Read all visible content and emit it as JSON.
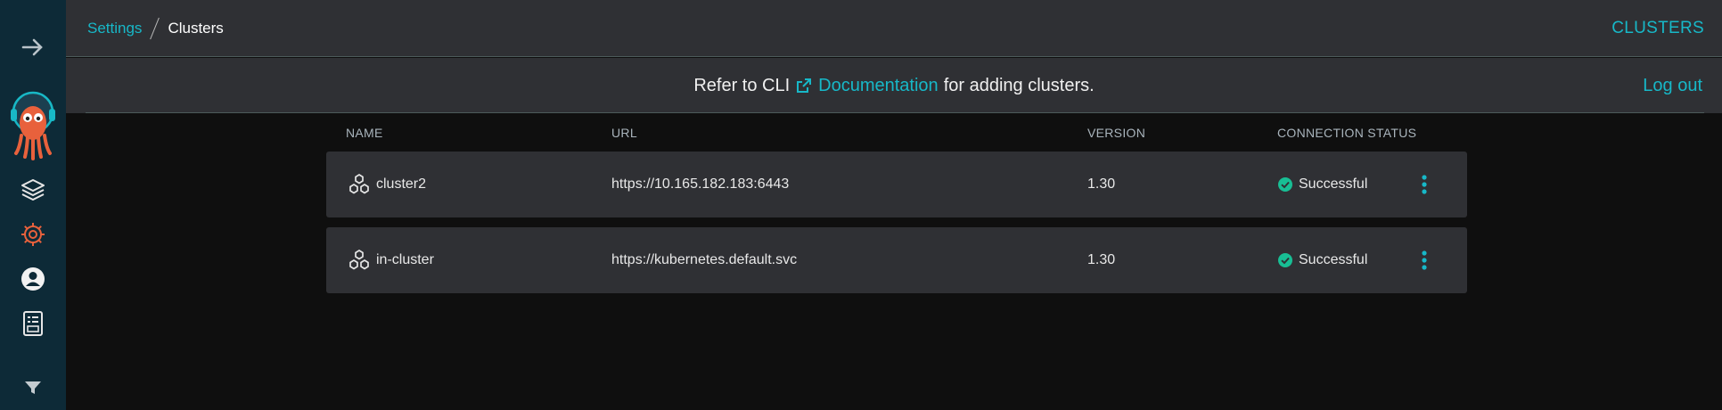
{
  "breadcrumb": {
    "parent": "Settings",
    "current": "Clusters"
  },
  "header": {
    "title": "CLUSTERS"
  },
  "notice": {
    "prefix": "Refer to CLI",
    "link": "Documentation",
    "suffix": "for adding clusters."
  },
  "logout_label": "Log out",
  "table": {
    "columns": [
      "NAME",
      "URL",
      "VERSION",
      "CONNECTION STATUS"
    ],
    "rows": [
      {
        "name": "cluster2",
        "url": "https://10.165.182.183:6443",
        "version": "1.30",
        "status": "Successful"
      },
      {
        "name": "in-cluster",
        "url": "https://kubernetes.default.svc",
        "version": "1.30",
        "status": "Successful"
      }
    ]
  },
  "sidebar": {
    "items": [
      {
        "icon": "arrow-right-icon"
      },
      {
        "icon": "argo-logo"
      },
      {
        "icon": "layers-icon"
      },
      {
        "icon": "gear-icon"
      },
      {
        "icon": "user-icon"
      },
      {
        "icon": "docs-icon"
      },
      {
        "icon": "filter-icon"
      }
    ]
  },
  "colors": {
    "accent": "#17b8c8",
    "success": "#18be94",
    "sidebar": "#0d2a37",
    "panel": "#2f3034",
    "background": "#0f0f0f",
    "logo": "#e8613c"
  }
}
